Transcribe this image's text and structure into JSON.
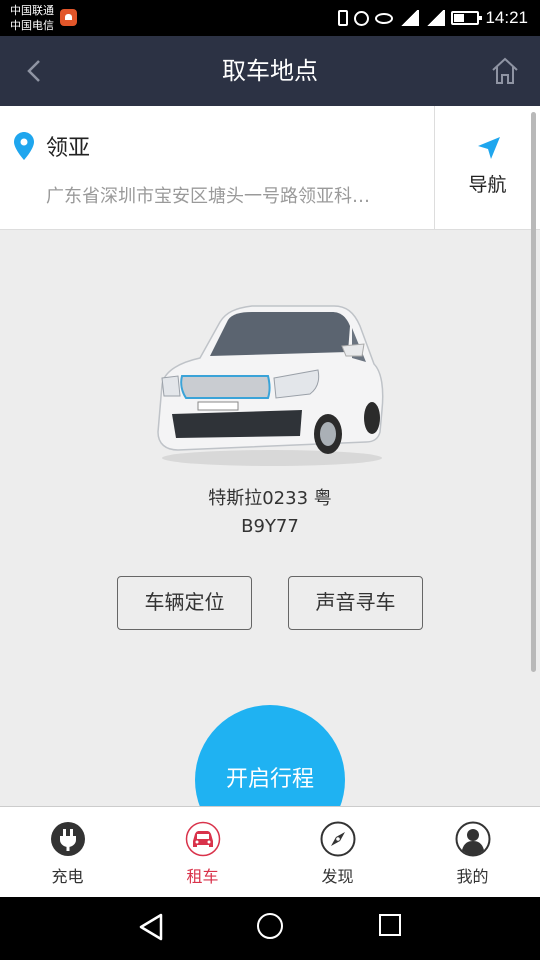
{
  "status_bar": {
    "carrier_1": "中国联通",
    "carrier_2": "中国电信",
    "time": "14:21"
  },
  "header": {
    "title": "取车地点"
  },
  "location": {
    "name": "领亚",
    "address": "广东省深圳市宝安区塘头一号路领亚科…",
    "nav_label": "导航"
  },
  "car": {
    "plate_line_1": "特斯拉0233 粤",
    "plate_line_2": "B9Y77",
    "actions": [
      "车辆定位",
      "声音寻车"
    ],
    "start_label": "开启行程"
  },
  "tabs": [
    {
      "label": "充电",
      "icon": "plug-icon"
    },
    {
      "label": "租车",
      "icon": "car-icon",
      "active": true
    },
    {
      "label": "发现",
      "icon": "compass-icon"
    },
    {
      "label": "我的",
      "icon": "user-icon"
    }
  ],
  "colors": {
    "header_bg": "#2c3244",
    "accent_blue": "#1fb2f2",
    "active_tab": "#d9334b"
  }
}
